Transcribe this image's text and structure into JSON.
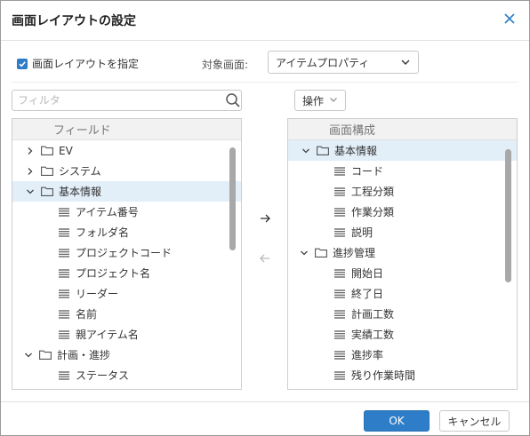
{
  "dialog": {
    "title": "画面レイアウトの設定",
    "close_icon": "close-icon"
  },
  "options": {
    "checkbox_label": "画面レイアウトを指定",
    "checkbox_checked": true,
    "target_label": "対象画面:",
    "target_value": "アイテムプロパティ"
  },
  "filter": {
    "placeholder": "フィルタ"
  },
  "operations": {
    "label": "操作"
  },
  "fields_panel": {
    "header": "フィールド",
    "items": [
      {
        "label": "EV",
        "type": "folder",
        "expanded": false
      },
      {
        "label": "システム",
        "type": "folder",
        "expanded": false
      },
      {
        "label": "基本情報",
        "type": "folder",
        "expanded": true,
        "selected": true
      },
      {
        "label": "アイテム番号",
        "type": "field"
      },
      {
        "label": "フォルダ名",
        "type": "field"
      },
      {
        "label": "プロジェクトコード",
        "type": "field"
      },
      {
        "label": "プロジェクト名",
        "type": "field"
      },
      {
        "label": "リーダー",
        "type": "field"
      },
      {
        "label": "名前",
        "type": "field"
      },
      {
        "label": "親アイテム名",
        "type": "field"
      },
      {
        "label": "計画・進捗",
        "type": "folder",
        "expanded": true
      },
      {
        "label": "ステータス",
        "type": "field"
      }
    ]
  },
  "layout_panel": {
    "header": "画面構成",
    "items": [
      {
        "label": "基本情報",
        "type": "folder",
        "expanded": true,
        "selected": true
      },
      {
        "label": "コード",
        "type": "field"
      },
      {
        "label": "工程分類",
        "type": "field"
      },
      {
        "label": "作業分類",
        "type": "field"
      },
      {
        "label": "説明",
        "type": "field"
      },
      {
        "label": "進捗管理",
        "type": "folder",
        "expanded": true
      },
      {
        "label": "開始日",
        "type": "field"
      },
      {
        "label": "終了日",
        "type": "field"
      },
      {
        "label": "計画工数",
        "type": "field"
      },
      {
        "label": "実績工数",
        "type": "field"
      },
      {
        "label": "進捗率",
        "type": "field"
      },
      {
        "label": "残り作業時間",
        "type": "field"
      }
    ]
  },
  "footer": {
    "ok_label": "OK",
    "cancel_label": "キャンセル"
  },
  "colors": {
    "accent": "#2e7dc8",
    "selection": "#e2eef8",
    "panel_header": "#f2f2f2"
  }
}
